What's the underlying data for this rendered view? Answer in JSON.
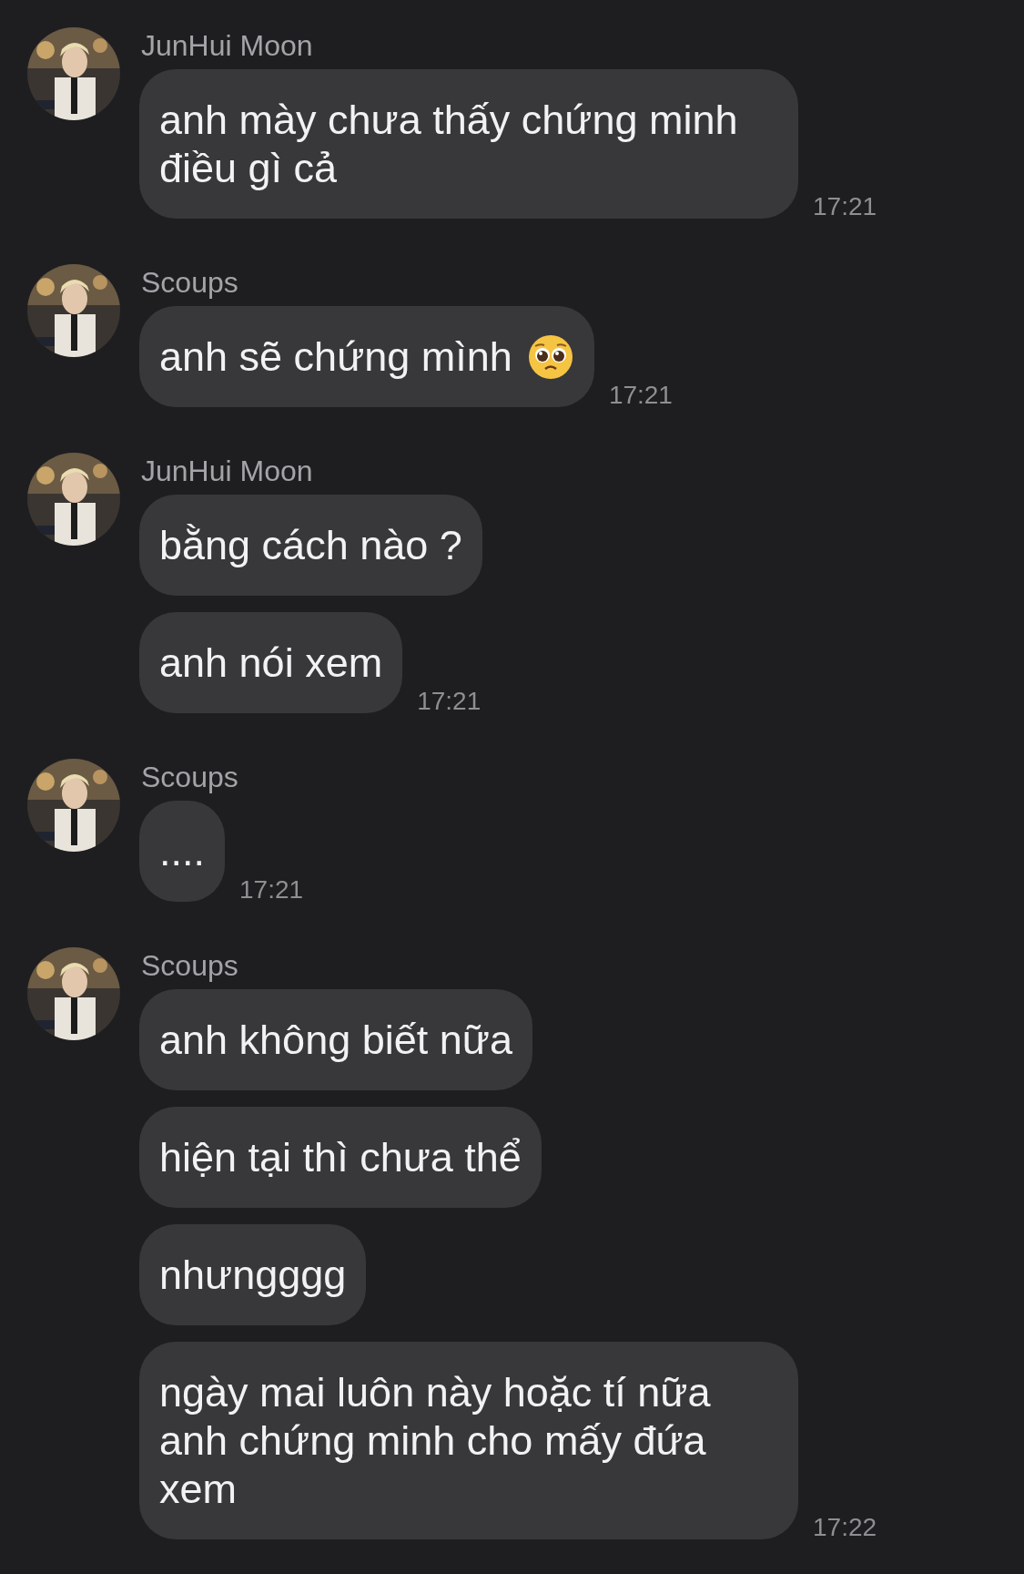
{
  "groups": [
    {
      "sender": "JunHui Moon",
      "avatar": {
        "kind": "picture"
      },
      "messages": [
        {
          "text": "anh mày chưa thấy chứng minh điều gì cả"
        }
      ],
      "time": "17:21"
    },
    {
      "sender": "Scoups",
      "avatar": {
        "kind": "picture"
      },
      "messages": [
        {
          "text": "anh sẽ chứng mình",
          "kind": "with-emoji"
        }
      ],
      "time": "17:21"
    },
    {
      "sender": "JunHui Moon",
      "avatar": {
        "kind": "picture"
      },
      "messages": [
        {
          "text": "bằng cách nào ?"
        },
        {
          "text": "anh nói xem"
        }
      ],
      "time": "17:21"
    },
    {
      "sender": "Scoups",
      "avatar": {
        "kind": "picture"
      },
      "messages": [
        {
          "text": "...."
        }
      ],
      "time": "17:21"
    },
    {
      "sender": "Scoups",
      "avatar": {
        "kind": "picture"
      },
      "messages": [
        {
          "text": "anh không biết nữa"
        },
        {
          "text": "hiện tại thì chưa thể"
        },
        {
          "text": "nhưngggg"
        },
        {
          "text": "ngày mai luôn này hoặc tí nữa anh chứng minh cho mấy đứa xem"
        }
      ],
      "time": "17:22"
    }
  ]
}
